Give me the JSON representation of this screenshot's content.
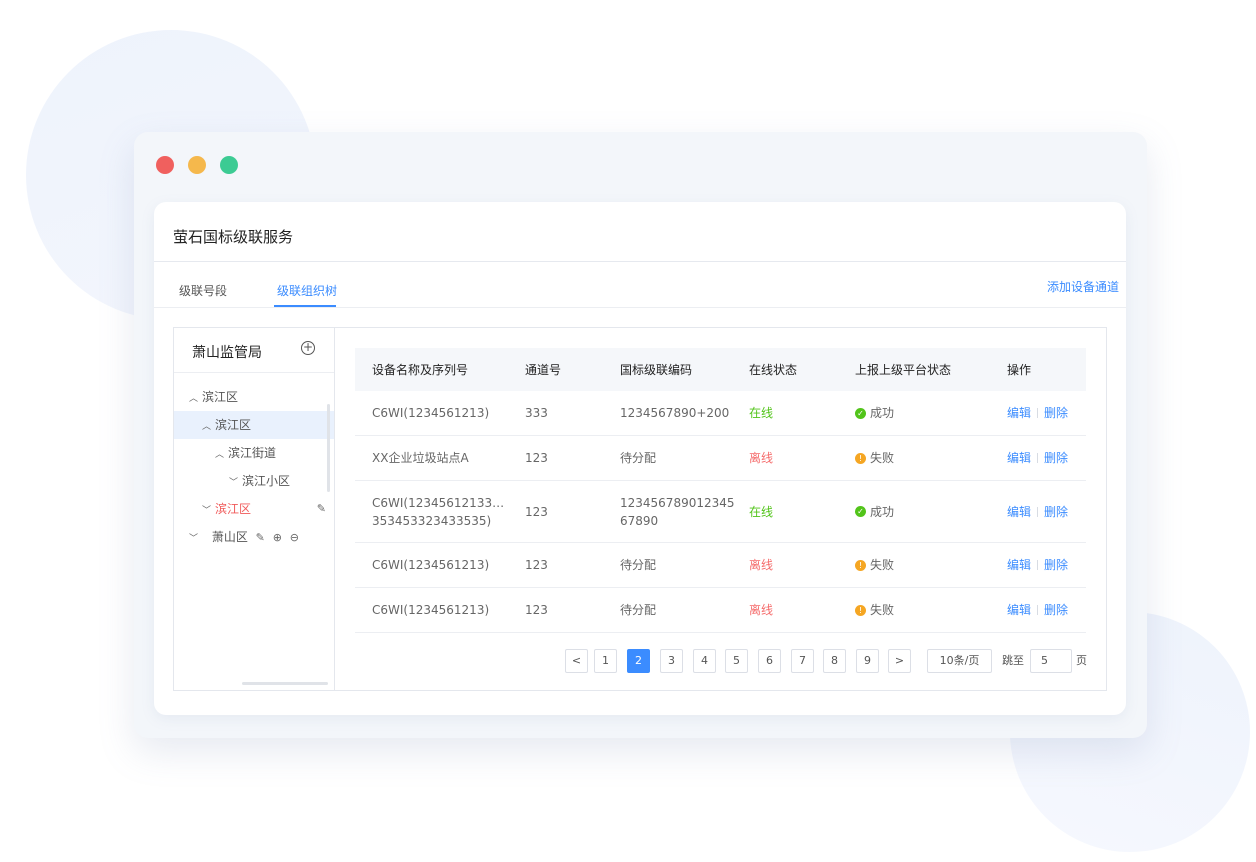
{
  "app": {
    "title": "萤石国标级联服务"
  },
  "tabs": [
    {
      "label": "级联号段",
      "active": false
    },
    {
      "label": "级联组织树",
      "active": true
    }
  ],
  "actions": {
    "add_channel": "添加设备通道"
  },
  "tree": {
    "title": "萧山监管局",
    "nodes": [
      {
        "label": "滨江区",
        "expanded": true
      },
      {
        "label": "滨江区",
        "expanded": true,
        "selected": true
      },
      {
        "label": "滨江街道",
        "expanded": true
      },
      {
        "label": "滨江小区",
        "expanded": false
      },
      {
        "label": "滨江区",
        "expanded": false,
        "highlight": "red"
      },
      {
        "label": "萧山区",
        "expanded": false
      }
    ]
  },
  "table": {
    "headers": [
      "设备名称及序列号",
      "通道号",
      "国标级联编码",
      "在线状态",
      "上报上级平台状态",
      "操作"
    ],
    "rows": [
      {
        "name": "C6WI(1234561213)",
        "channel": "333",
        "code": "1234567890+200",
        "online": "在线",
        "report": "成功",
        "edit": "编辑",
        "delete": "删除"
      },
      {
        "name": "XX企业垃圾站点A",
        "channel": "123",
        "code": "待分配",
        "online": "离线",
        "report": "失败",
        "edit": "编辑",
        "delete": "删除"
      },
      {
        "name": "C6WI(12345612133…",
        "name2": "353453323433535)",
        "channel": "123",
        "code": "123456789012345",
        "code2": "67890",
        "online": "在线",
        "report": "成功",
        "edit": "编辑",
        "delete": "删除"
      },
      {
        "name": "C6WI(1234561213)",
        "channel": "123",
        "code": "待分配",
        "online": "离线",
        "report": "失败",
        "edit": "编辑",
        "delete": "删除"
      },
      {
        "name": "C6WI(1234561213)",
        "channel": "123",
        "code": "待分配",
        "online": "离线",
        "report": "失败",
        "edit": "编辑",
        "delete": "删除"
      }
    ]
  },
  "pagination": {
    "prev": "<",
    "next": ">",
    "pages": [
      "1",
      "2",
      "3",
      "4",
      "5",
      "6",
      "7",
      "8",
      "9"
    ],
    "current": "2",
    "page_size": "10条/页",
    "jump_label": "跳至",
    "jump_value": "5",
    "page_suffix": "页"
  },
  "colors": {
    "accent": "#3b8cff",
    "online": "#52c41a",
    "offline": "#f56c6c",
    "warning": "#f5a623"
  }
}
